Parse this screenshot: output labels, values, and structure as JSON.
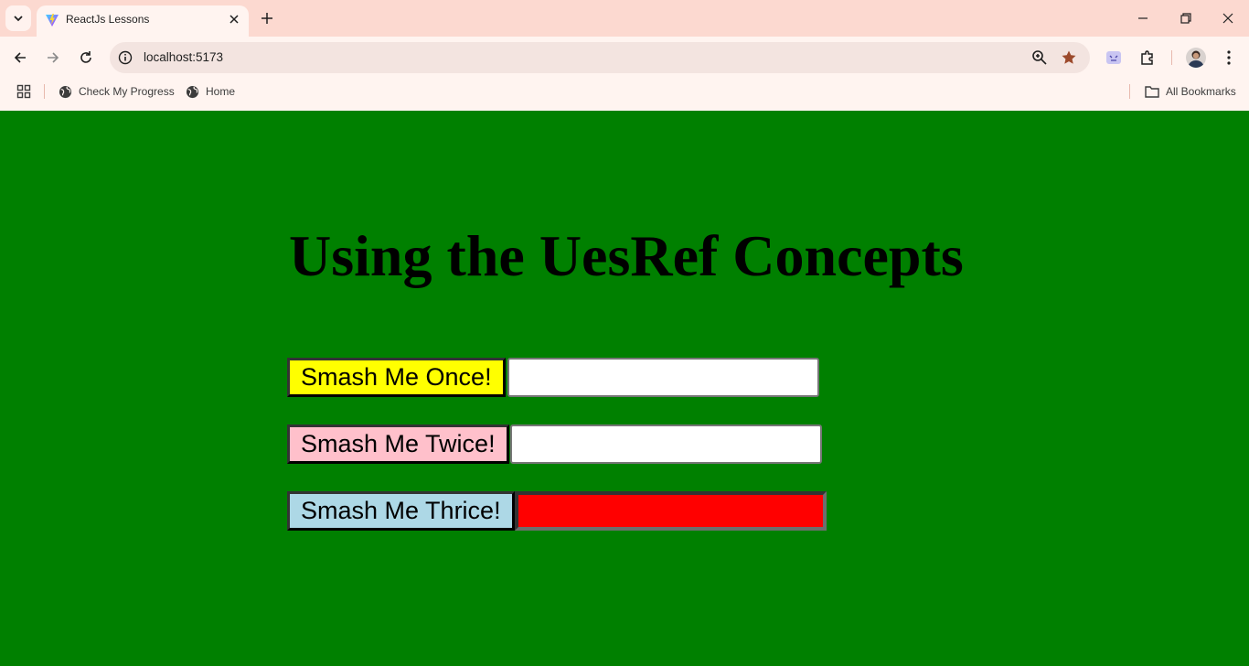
{
  "browser": {
    "tab_title": "ReactJs Lessons",
    "url": "localhost:5173",
    "bookmarks": [
      {
        "label": "Check My Progress",
        "icon": "globe-icon"
      },
      {
        "label": "Home",
        "icon": "globe-icon"
      }
    ],
    "all_bookmarks_label": "All Bookmarks"
  },
  "page": {
    "background_color": "#008000",
    "heading": "Using the UesRef Concepts",
    "rows": [
      {
        "button_label": "Smash Me Once!",
        "button_color": "#ffff00",
        "input_value": "",
        "input_color": "#ffffff"
      },
      {
        "button_label": "Smash Me Twice!",
        "button_color": "#ffc0cb",
        "input_value": "",
        "input_color": "#ffffff"
      },
      {
        "button_label": "Smash Me Thrice!",
        "button_color": "#add8e6",
        "input_value": "",
        "input_color": "#ff0000"
      }
    ]
  }
}
